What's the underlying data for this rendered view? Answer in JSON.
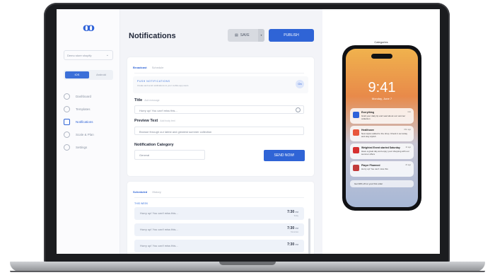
{
  "app": {
    "logo": "ꝏ"
  },
  "sidebar": {
    "select_value": "Demo store shopify",
    "platform": {
      "ios": "iOS",
      "android": "Android"
    },
    "items": [
      {
        "label": "Dashboard",
        "icon": "dashboard-icon"
      },
      {
        "label": "Templates",
        "icon": "templates-icon"
      },
      {
        "label": "Notifications",
        "icon": "bell-icon",
        "active": true
      },
      {
        "label": "Scale & Plan",
        "icon": "scale-icon"
      },
      {
        "label": "Settings",
        "icon": "gear-icon"
      }
    ]
  },
  "header": {
    "title": "Notifications",
    "save_label": "SAVE",
    "publish_label": "PUBLISH"
  },
  "broadcast": {
    "tabs": [
      "Broadcast",
      "Schedule"
    ],
    "push_label": "PUSH NOTIFICATIONS",
    "push_sub": "Create and send notifications to your mobile app users",
    "toggle": "On",
    "title_label": "Title",
    "title_hint": "Add message",
    "title_value": "Hurry up! You can't miss this...",
    "preview_label": "Preview Text",
    "preview_hint": "Add body text",
    "preview_value": "Browse through our latest and greatest summer collection",
    "category_label": "Notification Category",
    "category_value": "General",
    "send_label": "SEND NOW!"
  },
  "scheduled": {
    "tabs": [
      "Scheduled",
      "History"
    ],
    "section": "THIS WEEK",
    "rows": [
      {
        "text": "Hurry up! You can't miss this...",
        "time": "7:30",
        "ampm": "PM",
        "day": "Today"
      },
      {
        "text": "Hurry up! You can't miss this...",
        "time": "7:30",
        "ampm": "PM",
        "day": "Tomorrow"
      },
      {
        "text": "Hurry up! You can't miss this...",
        "time": "7:30",
        "ampm": "PM",
        "day": ""
      }
    ]
  },
  "preview": {
    "label": "Categories",
    "clock": "9:41",
    "date": "Monday, June 7",
    "notifications": [
      {
        "title": "Everything",
        "body": "Grab your daily tip and read about our summer collection",
        "time": "now",
        "color": "#2e62d9"
      },
      {
        "title": "Healthcare",
        "body": "New styles added to the shop. Check it out today and stay stylish",
        "time": "15m ago",
        "color": "#e8573c"
      },
      {
        "title": "Weighted Event started Saturday",
        "body": "Have a great day and enjoy your shopping with our summer offers",
        "time": "1h ago",
        "color": "#d63030"
      },
      {
        "title": "Player Pharmed",
        "body": "Hurry up! You can't miss this",
        "time": "2h ago",
        "color": "#c23b3b"
      }
    ],
    "footer": "Get 30% off on your first order"
  }
}
